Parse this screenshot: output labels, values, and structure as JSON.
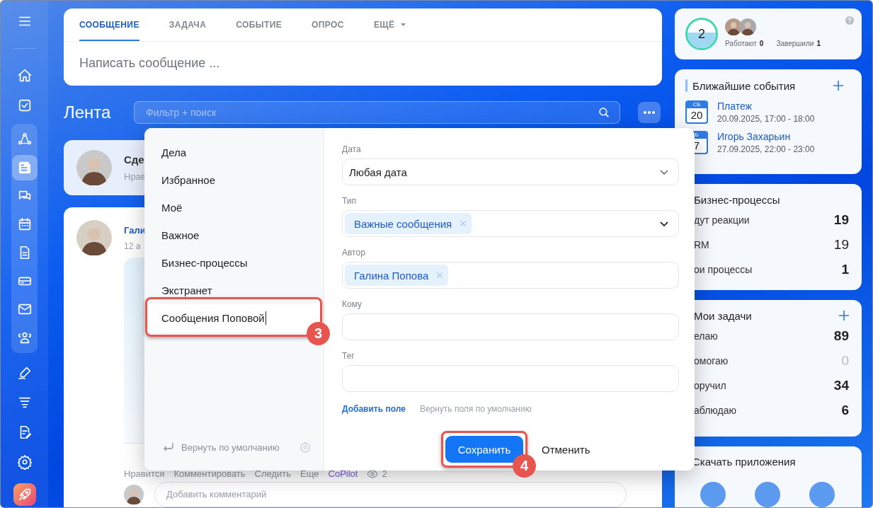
{
  "sidebar": {
    "top": [
      {
        "kind": "menu",
        "selected": false
      }
    ],
    "main": [
      {
        "kind": "home",
        "selected": false
      },
      {
        "kind": "tasks",
        "selected": false
      }
    ],
    "group": [
      {
        "kind": "flow",
        "selected": false
      },
      {
        "kind": "feed",
        "selected": true
      },
      {
        "kind": "chat",
        "selected": false
      },
      {
        "kind": "calendar",
        "selected": false
      },
      {
        "kind": "document",
        "selected": false
      },
      {
        "kind": "drive",
        "selected": false
      },
      {
        "kind": "mail",
        "selected": false
      },
      {
        "kind": "people",
        "selected": false
      }
    ],
    "bottom": [
      {
        "kind": "sign",
        "selected": false
      },
      {
        "kind": "funnel",
        "selected": false
      },
      {
        "kind": "edit",
        "selected": false
      },
      {
        "kind": "settings",
        "selected": false
      },
      {
        "kind": "rocket",
        "selected": false
      }
    ]
  },
  "composer": {
    "tabs": [
      {
        "label": "СООБЩЕНИЕ",
        "selected": true,
        "dropdown": false
      },
      {
        "label": "ЗАДАЧА",
        "selected": false,
        "dropdown": false
      },
      {
        "label": "СОБЫТИЕ",
        "selected": false,
        "dropdown": false
      },
      {
        "label": "ОПРОС",
        "selected": false,
        "dropdown": false
      },
      {
        "label": "ЕЩЁ",
        "selected": false,
        "dropdown": true
      }
    ],
    "placeholder": "Написать сообщение ..."
  },
  "feed": {
    "title": "Лента",
    "search": {
      "placeholder": "Фильтр + поиск"
    },
    "summary": {
      "title": "Сде",
      "meta": "Нрав"
    },
    "post": {
      "author": "Гали",
      "date": "12 а",
      "actions": [
        "Нравится",
        "Комментировать",
        "Следить",
        "Еще"
      ],
      "copilot": "CoPilot",
      "views": "2",
      "comment_placeholder": "Добавить комментарий"
    }
  },
  "filter_popup": {
    "presets": [
      {
        "label": "Дела",
        "editing": false
      },
      {
        "label": "Избранное",
        "editing": false
      },
      {
        "label": "Моё",
        "editing": false
      },
      {
        "label": "Важное",
        "editing": false
      },
      {
        "label": "Бизнес-процессы",
        "editing": false
      },
      {
        "label": "Экстранет",
        "editing": false
      },
      {
        "label": "Сообщения Поповой",
        "editing": true
      }
    ],
    "reset": "Вернуть по умолчанию",
    "fields": [
      {
        "label": "Дата",
        "kind": "select",
        "value": "Любая дата"
      },
      {
        "label": "Тип",
        "kind": "tags",
        "tags": [
          "Важные сообщения"
        ],
        "dropdown": true
      },
      {
        "label": "Автор",
        "kind": "tags",
        "tags": [
          "Галина Попова"
        ],
        "dropdown": false
      },
      {
        "label": "Кому",
        "kind": "text"
      },
      {
        "label": "Тег",
        "kind": "text"
      }
    ],
    "add_field": "Добавить поле",
    "restore_fields": "Вернуть поля по умолчанию",
    "save": "Сохранить",
    "cancel": "Отменить"
  },
  "annotations": [
    {
      "number": "3"
    },
    {
      "number": "4"
    }
  ],
  "right": {
    "status": {
      "count": "2",
      "working_label": "Работают",
      "working": "0",
      "done_label": "Завершили",
      "done": "1"
    },
    "events": {
      "title": "Ближайшие события",
      "items": [
        {
          "day": "СБ",
          "date": "20",
          "title": "Платеж",
          "time": "20.09.2025, 17:00 - 18:00"
        },
        {
          "day": "Б",
          "date": "7",
          "title": "Игорь Захарьин",
          "time": "27.09.2025, 22:00 - 23:00"
        }
      ]
    },
    "processes": {
      "title": "Бизнес-процессы",
      "rows": [
        {
          "label": "дут реакции",
          "count": "19",
          "bold": true,
          "muted": false
        },
        {
          "label": "RM",
          "count": "19",
          "bold": false,
          "muted": false
        },
        {
          "label": "ои процессы",
          "count": "1",
          "bold": true,
          "muted": false
        }
      ]
    },
    "tasks": {
      "title": "Мои задачи",
      "rows": [
        {
          "label": "елаю",
          "count": "89",
          "bold": true,
          "muted": false
        },
        {
          "label": "омогаю",
          "count": "0",
          "bold": false,
          "muted": true
        },
        {
          "label": "оручил",
          "count": "34",
          "bold": true,
          "muted": false
        },
        {
          "label": "аблюдаю",
          "count": "6",
          "bold": true,
          "muted": false
        }
      ]
    },
    "apps": {
      "title": "Скачать приложения"
    }
  }
}
